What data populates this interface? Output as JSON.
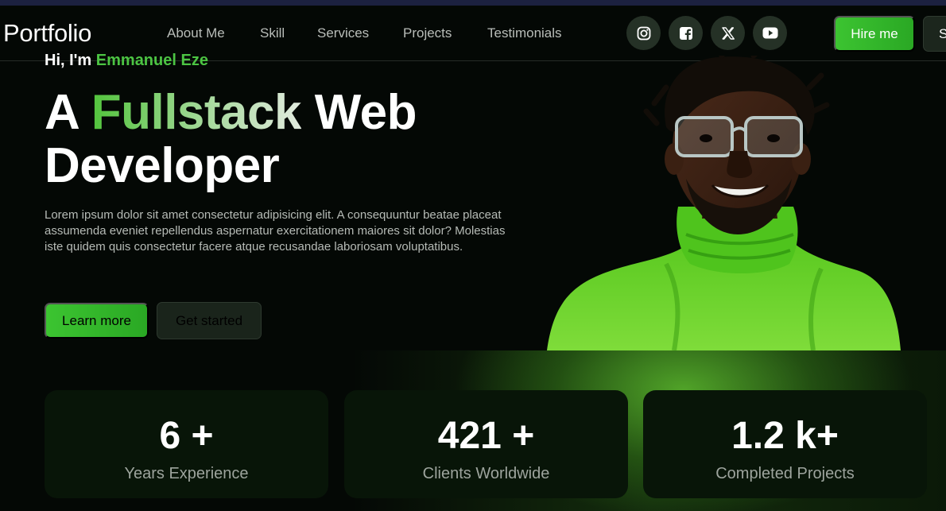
{
  "nav": {
    "logo": "Portfolio",
    "links": [
      "About Me",
      "Skill",
      "Services",
      "Projects",
      "Testimonials"
    ],
    "socials": [
      "instagram-icon",
      "facebook-icon",
      "x-icon",
      "youtube-icon"
    ],
    "hire_label": "Hire me",
    "extra_label": "S"
  },
  "hero": {
    "greeting": "Hi, I'm",
    "name": "Emmanuel Eze",
    "headline_prefix": "A",
    "headline_highlight": "Fullstack",
    "headline_suffix": "Web",
    "headline_line2": "Developer",
    "description": "Lorem ipsum dolor sit amet consectetur adipisicing elit. A consequuntur beatae placeat assumenda eveniet repellendus aspernatur exercitationem maiores sit dolor? Molestias iste quidem quis consectetur facere atque recusandae laboriosam voluptatibus.",
    "learn_more": "Learn more",
    "get_started": "Get started"
  },
  "stats": [
    {
      "value": "6 +",
      "label": "Years Experience"
    },
    {
      "value": "421 +",
      "label": "Clients Worldwide"
    },
    {
      "value": "1.2 k+",
      "label": "Completed Projects"
    }
  ],
  "colors": {
    "accent": "#3cc431",
    "background": "#040805",
    "card": "#081508",
    "sweater": "#6cd630"
  }
}
